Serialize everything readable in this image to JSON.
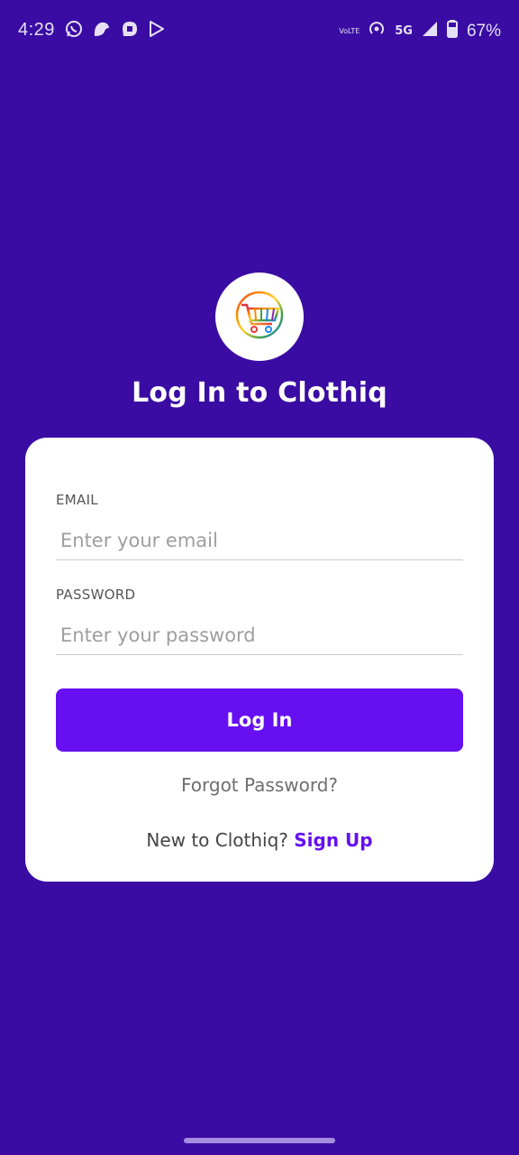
{
  "status_bar": {
    "time": "4:29",
    "app_icons": [
      "whatsapp-icon",
      "messenger-bird-icon",
      "chat-app-icon",
      "play-store-icon"
    ],
    "volte_label": "VoLTE",
    "network_label": "5G",
    "battery_percent": "67%"
  },
  "header": {
    "logo_icon": "shopping-cart-icon",
    "title": "Log In to Clothiq"
  },
  "form": {
    "email_label": "EMAIL",
    "email_placeholder": "Enter your email",
    "password_label": "PASSWORD",
    "password_placeholder": "Enter your password",
    "login_button_label": "Log In",
    "forgot_password_label": "Forgot Password?",
    "new_user_prompt": "New to Clothiq?",
    "signup_label": "Sign Up"
  },
  "colors": {
    "background": "#3a0ca3",
    "accent": "#6610f2",
    "card": "#ffffff"
  }
}
